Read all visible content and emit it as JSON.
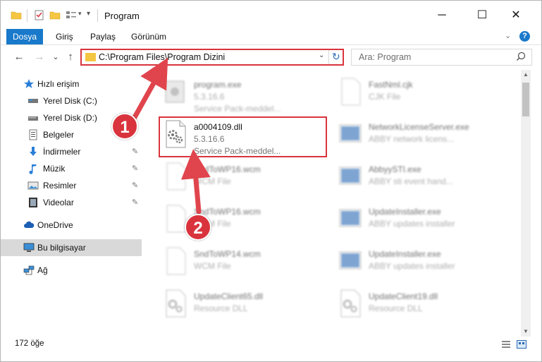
{
  "window": {
    "title": "Program",
    "minimize_glyph": "─",
    "maximize_glyph": "☐",
    "close_glyph": "✕"
  },
  "ribbon": {
    "tabs": [
      "Dosya",
      "Giriş",
      "Paylaş",
      "Görünüm"
    ],
    "help_glyph": "?"
  },
  "nav": {
    "back_glyph": "←",
    "forward_glyph": "→",
    "recent_glyph": "⌄",
    "up_glyph": "↑"
  },
  "address": {
    "path": "C:\\Program Files\\Program Dizini",
    "dropdown_glyph": "⌄",
    "refresh_glyph": "↻"
  },
  "search": {
    "placeholder": "Ara: Program"
  },
  "sidebar": {
    "items": [
      {
        "label": "Hızlı erişim",
        "icon": "star-icon"
      },
      {
        "label": "Yerel Disk (C:)",
        "icon": "drive-icon"
      },
      {
        "label": "Yerel Disk (D:)",
        "icon": "drive-icon"
      },
      {
        "label": "Belgeler",
        "icon": "documents-icon"
      },
      {
        "label": "İndirmeler",
        "icon": "download-icon"
      },
      {
        "label": "Müzik",
        "icon": "music-icon"
      },
      {
        "label": "Resimler",
        "icon": "pictures-icon"
      },
      {
        "label": "Videolar",
        "icon": "video-icon"
      },
      {
        "label": "OneDrive",
        "icon": "cloud-icon"
      },
      {
        "label": "Bu bilgisayar",
        "icon": "computer-icon"
      },
      {
        "label": "Ağ",
        "icon": "network-icon"
      }
    ],
    "pin_glyph": "📌"
  },
  "files": [
    {
      "name": "program.exe",
      "version": "5.3.16.6",
      "desc": "Service Pack-meddel..."
    },
    {
      "name": "FastNml.cjk",
      "version": "CJK File",
      "desc": ""
    },
    {
      "name": "a0004109.dll",
      "version": "5.3.16.6",
      "desc": "Service Pack-meddel..."
    },
    {
      "name": "NetworkLicenseServer.exe",
      "version": "ABBY network licens...",
      "desc": ""
    },
    {
      "name": "SndToWP16.wcm",
      "version": "WCM File",
      "desc": ""
    },
    {
      "name": "AbbyySTI.exe",
      "version": "ABBY sti event hand...",
      "desc": ""
    },
    {
      "name": "SndToWP16.wcm",
      "version": "WCM File",
      "desc": ""
    },
    {
      "name": "UpdateInstaller.exe",
      "version": "ABBY updates installer",
      "desc": ""
    },
    {
      "name": "SndToWP14.wcm",
      "version": "WCM File",
      "desc": ""
    },
    {
      "name": "UpdateInstaller.exe",
      "version": "ABBY updates installer",
      "desc": ""
    },
    {
      "name": "UpdateClient65.dll",
      "version": "Resource DLL",
      "desc": ""
    },
    {
      "name": "UpdateClient19.dll",
      "version": "Resource DLL",
      "desc": ""
    }
  ],
  "status": {
    "count": "172 öğe"
  },
  "callouts": [
    "1",
    "2"
  ],
  "colors": {
    "accent": "#1979ca",
    "highlight": "#d9343d",
    "folder": "#f5c642"
  }
}
